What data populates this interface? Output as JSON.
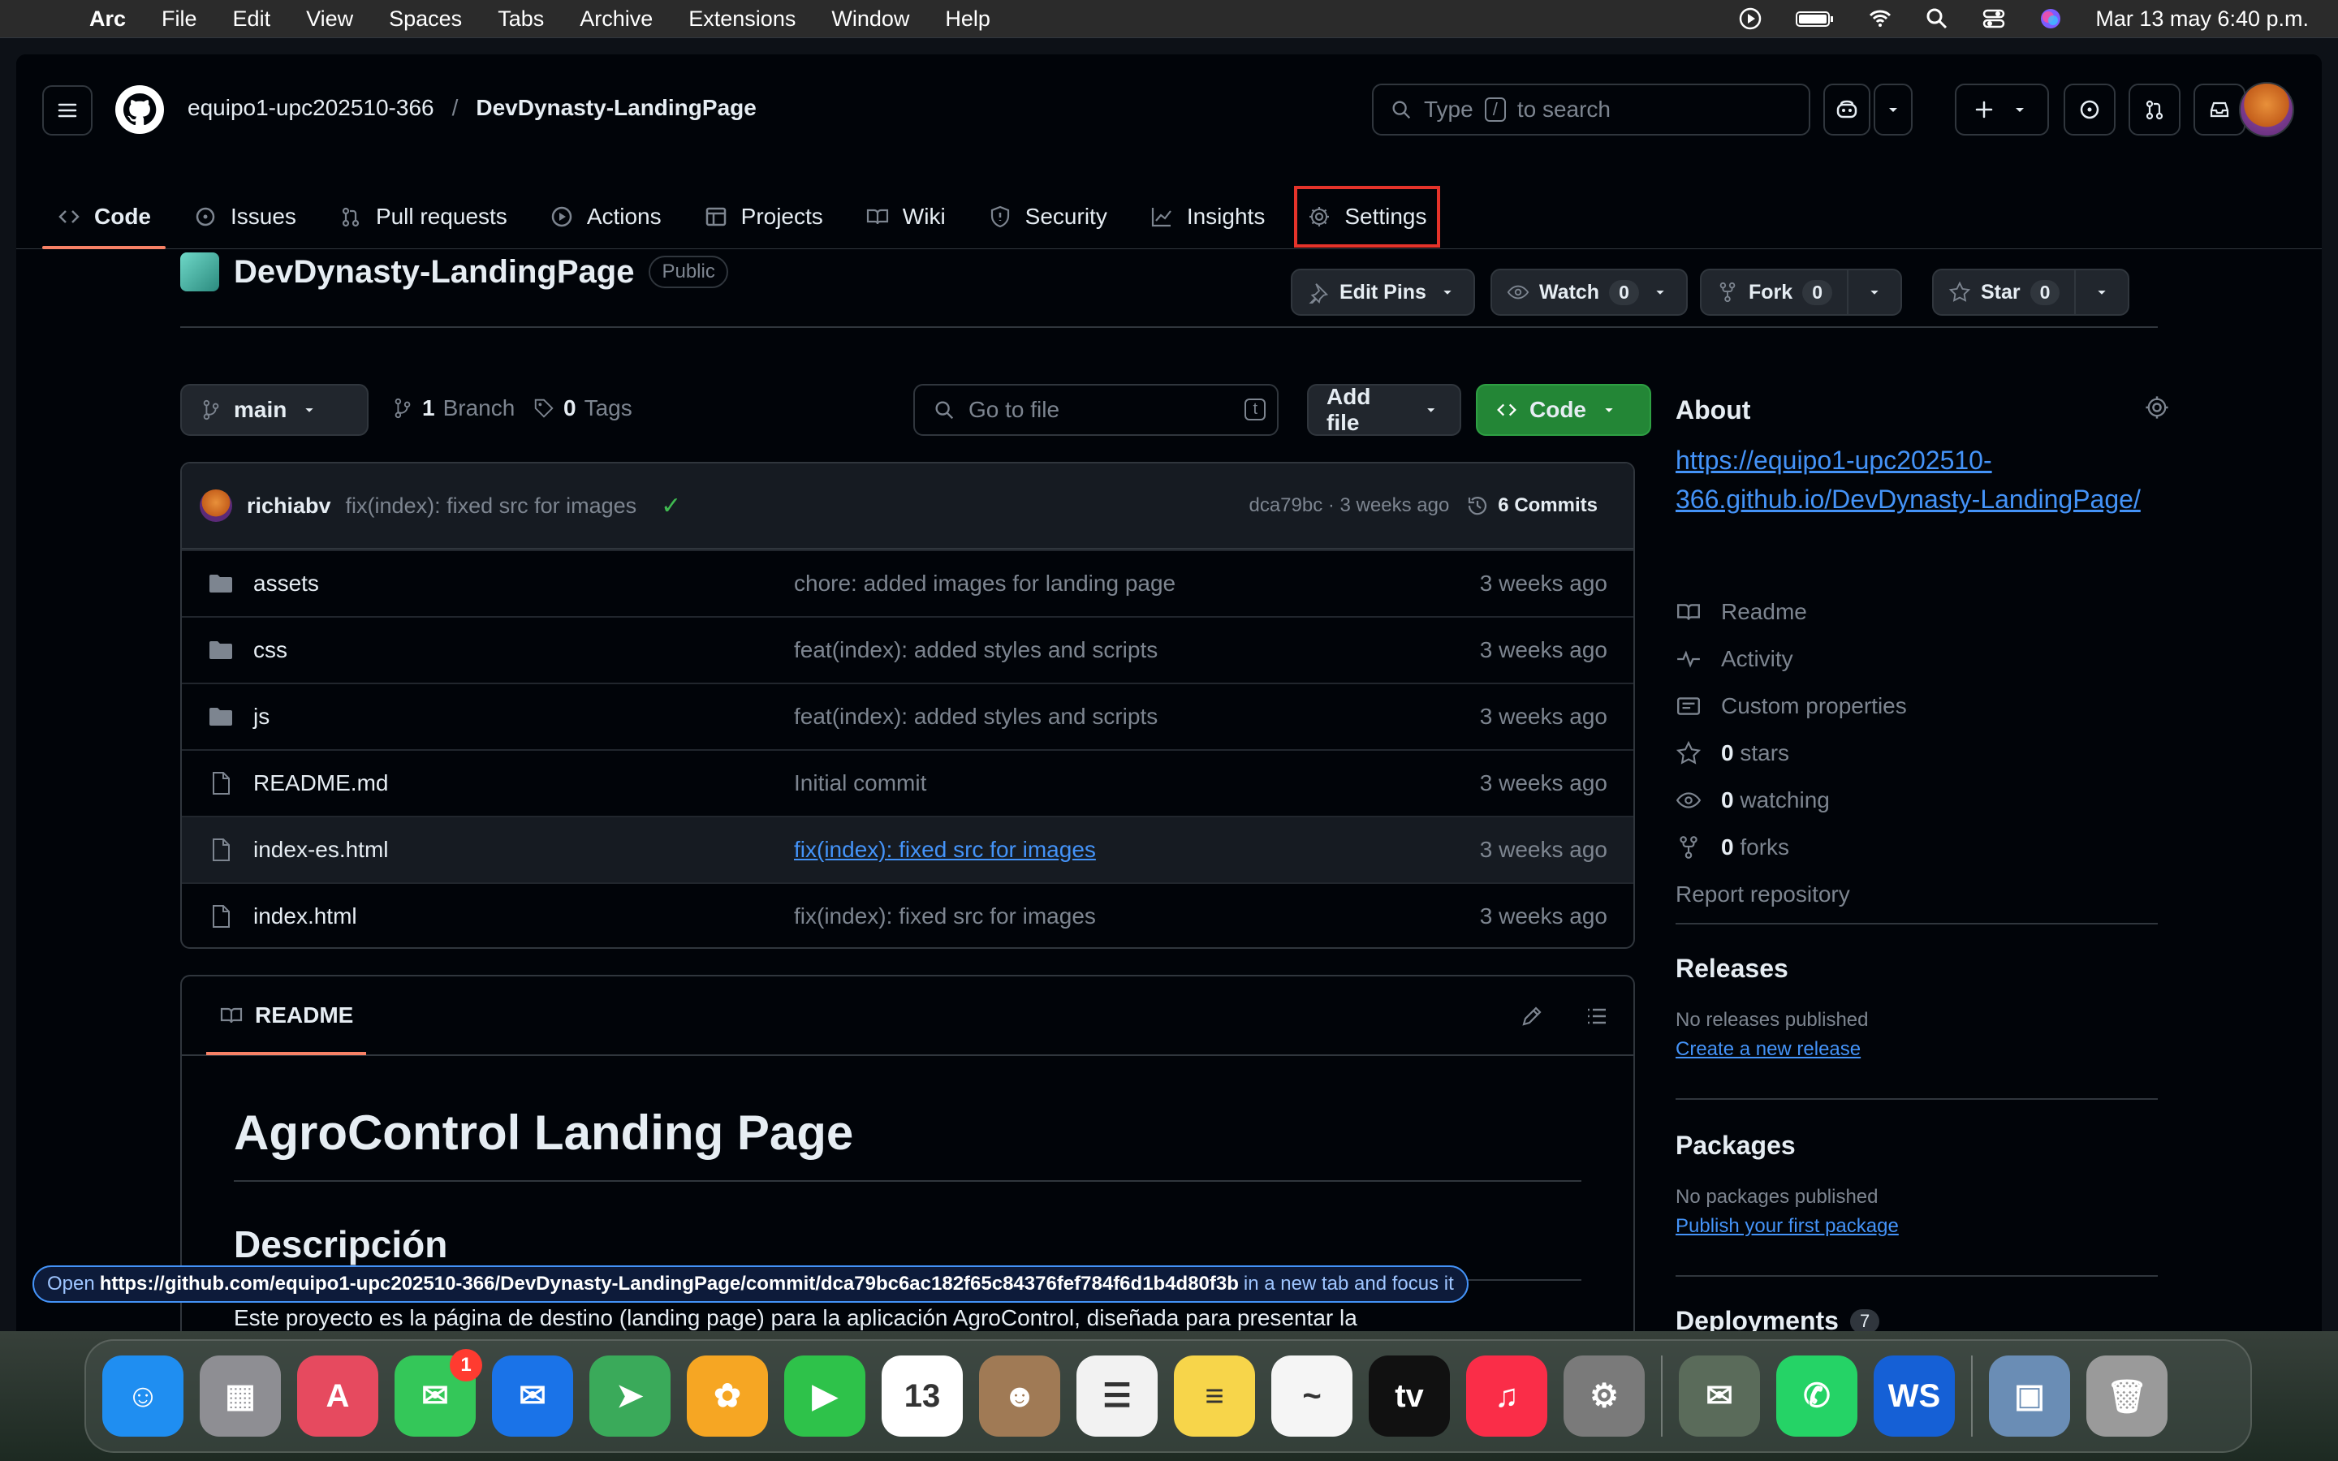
{
  "menubar": {
    "app": "Arc",
    "items": [
      "File",
      "Edit",
      "View",
      "Spaces",
      "Tabs",
      "Archive",
      "Extensions",
      "Window",
      "Help"
    ],
    "clock": "Mar 13 may 6:40 p.m."
  },
  "header": {
    "owner": "equipo1-upc202510-366",
    "separator": "/",
    "repo": "DevDynasty-LandingPage",
    "search_type": "Type",
    "search_key": "/",
    "search_rest": "to search"
  },
  "tabs": [
    {
      "label": "Code",
      "icon": "code-icon"
    },
    {
      "label": "Issues",
      "icon": "issue-icon"
    },
    {
      "label": "Pull requests",
      "icon": "pull-request-icon"
    },
    {
      "label": "Actions",
      "icon": "play-icon"
    },
    {
      "label": "Projects",
      "icon": "table-icon"
    },
    {
      "label": "Wiki",
      "icon": "book-icon"
    },
    {
      "label": "Security",
      "icon": "shield-icon"
    },
    {
      "label": "Insights",
      "icon": "graph-icon"
    },
    {
      "label": "Settings",
      "icon": "gear-icon"
    }
  ],
  "repo": {
    "name": "DevDynasty-LandingPage",
    "visibility": "Public",
    "edit_pins": "Edit Pins",
    "watch": "Watch",
    "watch_count": "0",
    "fork": "Fork",
    "fork_count": "0",
    "star": "Star",
    "star_count": "0"
  },
  "toolbar": {
    "branch": "main",
    "branch_count": "1",
    "branch_label": "Branch",
    "tag_count": "0",
    "tag_label": "Tags",
    "goto_placeholder": "Go to file",
    "goto_key": "t",
    "add_file": "Add file",
    "code": "Code"
  },
  "commit": {
    "user": "richiabv",
    "message": "fix(index): fixed src for images",
    "hash_time": "dca79bc · 3 weeks ago",
    "commits": "6 Commits"
  },
  "files": [
    {
      "type": "folder",
      "name": "assets",
      "message": "chore: added images for landing page",
      "time": "3 weeks ago"
    },
    {
      "type": "folder",
      "name": "css",
      "message": "feat(index): added styles and scripts",
      "time": "3 weeks ago"
    },
    {
      "type": "folder",
      "name": "js",
      "message": "feat(index): added styles and scripts",
      "time": "3 weeks ago"
    },
    {
      "type": "file",
      "name": "README.md",
      "message": "Initial commit",
      "time": "3 weeks ago"
    },
    {
      "type": "file",
      "name": "index-es.html",
      "message": "fix(index): fixed src for images",
      "time": "3 weeks ago"
    },
    {
      "type": "file",
      "name": "index.html",
      "message": "fix(index): fixed src for images",
      "time": "3 weeks ago"
    }
  ],
  "readme": {
    "tab": "README",
    "h1": "AgroControl Landing Page",
    "h2": "Descripción",
    "paragraph": "Este proyecto es la página de destino (landing page) para la aplicación AgroControl, diseñada para presentar la"
  },
  "about": {
    "title": "About",
    "link": "https://equipo1-upc202510-366.github.io/DevDynasty-LandingPage/",
    "items": [
      {
        "icon": "book-icon",
        "bold": "",
        "label": "Readme"
      },
      {
        "icon": "pulse-icon",
        "bold": "",
        "label": "Activity"
      },
      {
        "icon": "note-icon",
        "bold": "",
        "label": "Custom properties"
      },
      {
        "icon": "star-icon",
        "bold": "0",
        "label": "stars"
      },
      {
        "icon": "eye-icon",
        "bold": "0",
        "label": "watching"
      },
      {
        "icon": "fork-icon",
        "bold": "0",
        "label": "forks"
      }
    ],
    "report": "Report repository"
  },
  "releases": {
    "title": "Releases",
    "empty": "No releases published",
    "link": "Create a new release"
  },
  "packages": {
    "title": "Packages",
    "empty": "No packages published",
    "link": "Publish your first package"
  },
  "deployments": {
    "title": "Deployments",
    "count": "7"
  },
  "status_url": {
    "prefix": "Open",
    "url": "https://github.com/equipo1-upc202510-366/DevDynasty-LandingPage/commit/dca79bc6ac182f65c84376fef784f6d1b4d80f3b",
    "suffix": "in a new tab and focus it"
  },
  "dock": [
    {
      "name": "finder",
      "color": "#1f8ef1",
      "glyph": "☺"
    },
    {
      "name": "launchpad",
      "color": "#8e8e93",
      "glyph": "▦"
    },
    {
      "name": "arc",
      "color": "#e64a5f",
      "glyph": "A"
    },
    {
      "name": "messages",
      "color": "#34c759",
      "glyph": "✉",
      "badge": "1"
    },
    {
      "name": "mail",
      "color": "#1a73e8",
      "glyph": "✉"
    },
    {
      "name": "maps",
      "color": "#3aaa5a",
      "glyph": "➤"
    },
    {
      "name": "photos",
      "color": "#f6a623",
      "glyph": "✿"
    },
    {
      "name": "facetime",
      "color": "#2ec24a",
      "glyph": "▶"
    },
    {
      "name": "calendar",
      "color": "#ffffff",
      "glyph": "13"
    },
    {
      "name": "contacts",
      "color": "#a07a55",
      "glyph": "☻"
    },
    {
      "name": "reminders",
      "color": "#f2f2f2",
      "glyph": "☰"
    },
    {
      "name": "notes",
      "color": "#f7d54a",
      "glyph": "≡"
    },
    {
      "name": "freeform",
      "color": "#f5f5f5",
      "glyph": "~"
    },
    {
      "name": "apple-tv",
      "color": "#111111",
      "glyph": "tv"
    },
    {
      "name": "music",
      "color": "#fa2d48",
      "glyph": "♫"
    },
    {
      "name": "system-settings",
      "color": "#7a7a7a",
      "glyph": "⚙"
    },
    {
      "name": "mail-app",
      "color": "#5a6b5a",
      "glyph": "✉"
    },
    {
      "name": "whatsapp",
      "color": "#25d366",
      "glyph": "✆"
    },
    {
      "name": "webstorm",
      "color": "#1560d6",
      "glyph": "WS"
    },
    {
      "name": "preview",
      "color": "#6a8db5",
      "glyph": "▣"
    },
    {
      "name": "trash",
      "color": "#9a9a9a",
      "glyph": "🗑"
    }
  ],
  "colors": {
    "accent_link": "#4493f8",
    "green_button": "#238636",
    "tab_underline": "#f78166",
    "settings_highlight": "#e5332a"
  }
}
